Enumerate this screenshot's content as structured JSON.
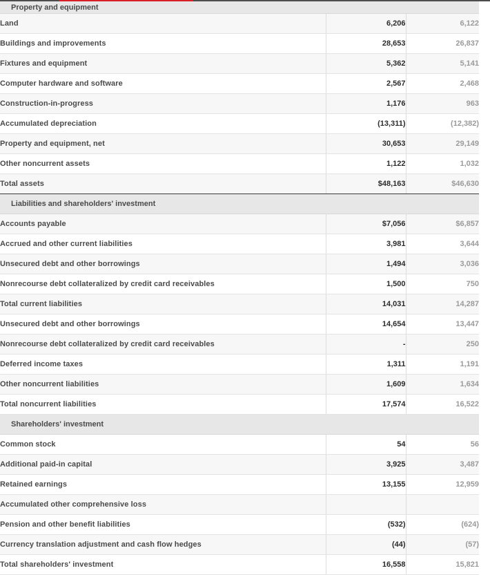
{
  "document": {
    "type": "consolidated-balance-sheet",
    "accent_color": "#d81f26",
    "column_current_color": "#2b2b2b",
    "column_prior_color": "#9a9a9a",
    "section_header_bg": "#e7e7e7",
    "row_shade_bg": "#f7f7f7"
  },
  "sections": [
    {
      "id": "property-and-equipment",
      "header": "Property and equipment",
      "header_compact": true,
      "rows": [
        {
          "label": "Land",
          "indent": 2,
          "current": "6,206",
          "prior": "6,122",
          "shade": true,
          "rule_top": false,
          "rule_bottom": false
        },
        {
          "label": "Buildings and improvements",
          "indent": 2,
          "current": "28,653",
          "prior": "26,837",
          "shade": false,
          "rule_top": false,
          "rule_bottom": false
        },
        {
          "label": "Fixtures and equipment",
          "indent": 2,
          "current": "5,362",
          "prior": "5,141",
          "shade": true,
          "rule_top": false,
          "rule_bottom": false
        },
        {
          "label": "Computer hardware and software",
          "indent": 2,
          "current": "2,567",
          "prior": "2,468",
          "shade": false,
          "rule_top": false,
          "rule_bottom": false
        },
        {
          "label": "Construction-in-progress",
          "indent": 2,
          "current": "1,176",
          "prior": "963",
          "shade": true,
          "rule_top": false,
          "rule_bottom": false
        },
        {
          "label": "Accumulated depreciation",
          "indent": 2,
          "current": "(13,311)",
          "prior": "(12,382)",
          "shade": false,
          "rule_top": false,
          "rule_bottom": false
        },
        {
          "label": "Property and equipment, net",
          "indent": 2,
          "current": "30,653",
          "prior": "29,149",
          "shade": true,
          "rule_top": true,
          "rule_bottom": false
        },
        {
          "label": "Other noncurrent assets",
          "indent": 1,
          "current": "1,122",
          "prior": "1,032",
          "shade": false,
          "rule_top": false,
          "rule_bottom": false
        },
        {
          "label": "Total assets",
          "indent": 1,
          "current": "$48,163",
          "prior": "$46,630",
          "shade": true,
          "rule_top": true,
          "rule_bottom": true
        }
      ]
    },
    {
      "id": "liabilities-and-shareholders-investment",
      "header": "Liabilities and shareholders' investment",
      "header_compact": false,
      "rows": [
        {
          "label": "Accounts payable",
          "indent": 1,
          "current": "$7,056",
          "prior": "$6,857",
          "shade": true,
          "rule_top": false,
          "rule_bottom": false
        },
        {
          "label": "Accrued and other current liabilities",
          "indent": 1,
          "current": "3,981",
          "prior": "3,644",
          "shade": false,
          "rule_top": false,
          "rule_bottom": false
        },
        {
          "label": "Unsecured debt and other borrowings",
          "indent": 1,
          "current": "1,494",
          "prior": "3,036",
          "shade": true,
          "rule_top": false,
          "rule_bottom": false
        },
        {
          "label": "Nonrecourse debt collateralized by credit card receivables",
          "indent": 1,
          "current": "1,500",
          "prior": "750",
          "shade": false,
          "rule_top": false,
          "rule_bottom": false
        },
        {
          "label": "Total current liabilities",
          "indent": 2,
          "current": "14,031",
          "prior": "14,287",
          "shade": true,
          "rule_top": true,
          "rule_bottom": false
        },
        {
          "label": "Unsecured debt and other borrowings",
          "indent": 1,
          "current": "14,654",
          "prior": "13,447",
          "shade": false,
          "rule_top": true,
          "rule_bottom": false
        },
        {
          "label": "Nonrecourse debt collateralized by credit card receivables",
          "indent": 1,
          "current": "-",
          "prior": "250",
          "shade": true,
          "rule_top": false,
          "rule_bottom": false
        },
        {
          "label": "Deferred income taxes",
          "indent": 1,
          "current": "1,311",
          "prior": "1,191",
          "shade": false,
          "rule_top": false,
          "rule_bottom": false
        },
        {
          "label": "Other noncurrent liabilities",
          "indent": 1,
          "current": "1,609",
          "prior": "1,634",
          "shade": true,
          "rule_top": false,
          "rule_bottom": false
        },
        {
          "label": "Total noncurrent liabilities",
          "indent": 2,
          "current": "17,574",
          "prior": "16,522",
          "shade": false,
          "rule_top": true,
          "rule_bottom": false
        }
      ]
    },
    {
      "id": "shareholders-investment",
      "header": "Shareholders' investment",
      "header_compact": false,
      "rows": [
        {
          "label": "Common stock",
          "indent": 1,
          "current": "54",
          "prior": "56",
          "shade": false,
          "rule_top": false,
          "rule_bottom": false
        },
        {
          "label": "Additional paid-in capital",
          "indent": 1,
          "current": "3,925",
          "prior": "3,487",
          "shade": true,
          "rule_top": false,
          "rule_bottom": false
        },
        {
          "label": "Retained earnings",
          "indent": 1,
          "current": "13,155",
          "prior": "12,959",
          "shade": false,
          "rule_top": false,
          "rule_bottom": false
        },
        {
          "label": "Accumulated other comprehensive loss",
          "indent": 1,
          "current": "",
          "prior": "",
          "shade": true,
          "rule_top": false,
          "rule_bottom": false
        },
        {
          "label": "Pension and other benefit liabilities",
          "indent": 2,
          "current": "(532)",
          "prior": "(624)",
          "shade": false,
          "rule_top": false,
          "rule_bottom": false
        },
        {
          "label": "Currency translation adjustment and cash flow hedges",
          "indent": 2,
          "current": "(44)",
          "prior": "(57)",
          "shade": true,
          "rule_top": false,
          "rule_bottom": false
        },
        {
          "label": "Total shareholders' investment",
          "indent": 1,
          "current": "16,558",
          "prior": "15,821",
          "shade": false,
          "rule_top": true,
          "rule_bottom": false
        }
      ]
    }
  ]
}
